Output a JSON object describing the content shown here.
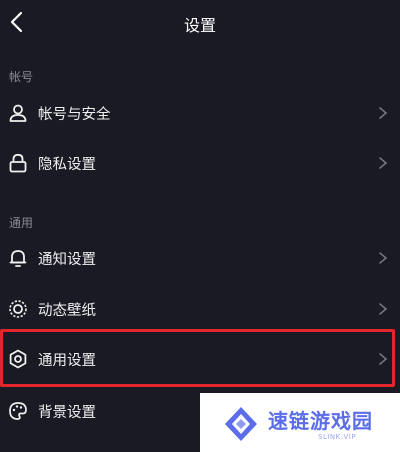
{
  "header": {
    "title": "设置"
  },
  "sections": {
    "account": "帐号",
    "general": "通用"
  },
  "items": [
    {
      "label": "帐号与安全",
      "icon": "user-icon"
    },
    {
      "label": "隐私设置",
      "icon": "lock-icon"
    },
    {
      "label": "通知设置",
      "icon": "bell-icon"
    },
    {
      "label": "动态壁纸",
      "icon": "wallpaper-icon"
    },
    {
      "label": "通用设置",
      "icon": "gear-icon",
      "highlighted": true
    },
    {
      "label": "背景设置",
      "icon": "palette-icon"
    }
  ],
  "watermark": {
    "text": "速链游戏园",
    "sub": "SLINK.VIP"
  },
  "colors": {
    "background": "#1a1a24",
    "highlight": "#e3262c",
    "watermark": "#5b6de8"
  }
}
